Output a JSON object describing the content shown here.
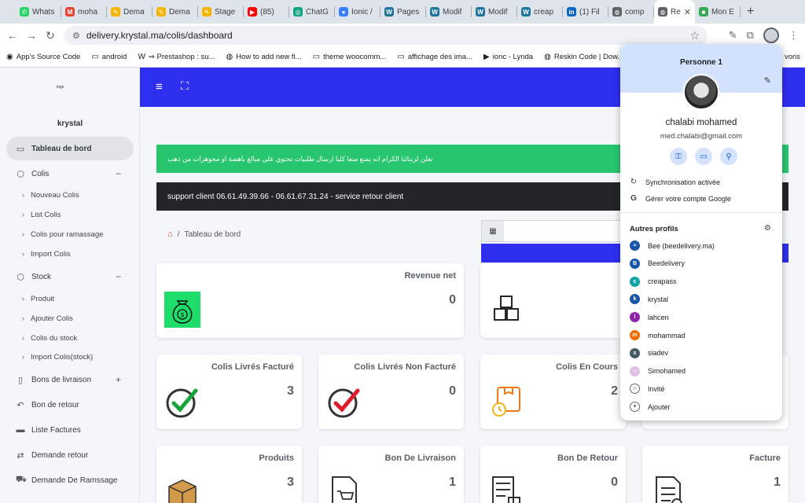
{
  "browser": {
    "tabs": [
      {
        "label": "Whats",
        "fav": "whatsapp-icon",
        "color": "#25d366",
        "glyph": "✆"
      },
      {
        "label": "moha",
        "fav": "gmail-icon",
        "color": "#ea4335",
        "glyph": "M"
      },
      {
        "label": "Dema",
        "fav": "page-icon",
        "color": "#f4b400",
        "glyph": "✎"
      },
      {
        "label": "Dema",
        "fav": "page-icon",
        "color": "#f4b400",
        "glyph": "✎"
      },
      {
        "label": "Stage",
        "fav": "page-icon",
        "color": "#f4b400",
        "glyph": "✎"
      },
      {
        "label": "(85)",
        "fav": "youtube-icon",
        "color": "#ff0000",
        "glyph": "▶"
      },
      {
        "label": "ChatG",
        "fav": "chatgpt-icon",
        "color": "#10a37f",
        "glyph": "◎"
      },
      {
        "label": "Ionic /",
        "fav": "ionic-icon",
        "color": "#3880ff",
        "glyph": "●"
      },
      {
        "label": "Pages",
        "fav": "wordpress-icon",
        "color": "#21759b",
        "glyph": "W"
      },
      {
        "label": "Modif",
        "fav": "wordpress-icon",
        "color": "#21759b",
        "glyph": "W"
      },
      {
        "label": "Modif",
        "fav": "wordpress-icon",
        "color": "#21759b",
        "glyph": "W"
      },
      {
        "label": "creap",
        "fav": "wordpress-icon",
        "color": "#21759b",
        "glyph": "W"
      },
      {
        "label": "(1) Fil",
        "fav": "linkedin-icon",
        "color": "#0a66c2",
        "glyph": "in"
      },
      {
        "label": "comp",
        "fav": "globe-icon",
        "color": "#5f6368",
        "glyph": "◍"
      },
      {
        "label": "Re",
        "fav": "globe-icon",
        "color": "#5f6368",
        "glyph": "◍"
      },
      {
        "label": "Mon E",
        "fav": "app-icon",
        "color": "#34a853",
        "glyph": "■"
      }
    ],
    "url": "delivery.krystal.ma/colis/dashboard",
    "bookmarks": [
      {
        "label": "App's Source Code",
        "icon": "folder-blue-icon",
        "glyph": "◉"
      },
      {
        "label": "android",
        "icon": "folder-icon",
        "glyph": "▭"
      },
      {
        "label": "⇒ Prestashop : su...",
        "icon": "wordpress-icon",
        "glyph": "W"
      },
      {
        "label": "How to add new fi...",
        "icon": "globe-icon",
        "glyph": "◍"
      },
      {
        "label": "theme woocomm...",
        "icon": "folder-icon",
        "glyph": "▭"
      },
      {
        "label": "affichage des ima...",
        "icon": "folder-icon",
        "glyph": "▭"
      },
      {
        "label": "ionc - Lynda",
        "icon": "video-icon",
        "glyph": "▶"
      },
      {
        "label": "Reskin Code | Dow...",
        "icon": "globe-icon",
        "glyph": "◍"
      },
      {
        "label": "voris",
        "icon": "folder-icon",
        "glyph": ""
      }
    ]
  },
  "sidebar": {
    "logo": "logo",
    "user": "krystal",
    "items": {
      "dashboard": "Tableau de bord",
      "colis": "Colis",
      "nouveau": "Nouveau Colis",
      "list": "List Colis",
      "ramassage": "Colis pour ramassage",
      "import": "Import Colis",
      "stock": "Stock",
      "produit": "Produit",
      "ajouter": "Ajouter Colis",
      "colis_stock": "Colis du stock",
      "import_stock": "Import Colis(stock)",
      "bons": "Bons de livraison",
      "retour": "Bon de retour",
      "factures": "Liste Factures",
      "demande_retour": "Demande retour",
      "demande_ramassage": "Demande De Ramssage"
    }
  },
  "main": {
    "alert_green": "نعلن لزبنائنا الكرام انه يمنع منعا كليا ارسال طلبيات تحتوي على مبالغ باهضة او مجوهرات من ذهب",
    "alert_dark": "support client 06.61.49.39.66 - 06.61.67.31.24 - service retour client",
    "breadcrumb": "Tableau de bord",
    "cards": {
      "revenue": {
        "title": "Revenue net",
        "value": "0"
      },
      "livres_f": {
        "title": "Colis Livrés Facturé",
        "value": "3"
      },
      "livres_nf": {
        "title": "Colis Livrés Non Facturé",
        "value": "0"
      },
      "en_cours": {
        "title": "Colis En Cours",
        "value": "2"
      },
      "produits": {
        "title": "Produits",
        "value": "3"
      },
      "bon_liv": {
        "title": "Bon De Livraison",
        "value": "1"
      },
      "bon_ret": {
        "title": "Bon De Retour",
        "value": "0"
      },
      "facture": {
        "title": "Facture",
        "value": "1"
      }
    }
  },
  "profile": {
    "header": "Personne 1",
    "name": "chalabi mohamed",
    "email": "med.chalabi@gmail.com",
    "sync": "Synchronisation activée",
    "manage": "Gérer votre compte Google",
    "others": "Autres profils",
    "profiles": [
      {
        "name": "Bee (beedelivery.ma)",
        "color": "#1a56a8",
        "initial": "≈"
      },
      {
        "name": "Beedelivery",
        "color": "#1a56a8",
        "initial": "B"
      },
      {
        "name": "creapass",
        "color": "#12a4a4",
        "initial": "c"
      },
      {
        "name": "krystal",
        "color": "#1a56a8",
        "initial": "k"
      },
      {
        "name": "lahcen",
        "color": "#8e24aa",
        "initial": "l"
      },
      {
        "name": "mohammad",
        "color": "#ef6c00",
        "initial": "m"
      },
      {
        "name": "siadev",
        "color": "#455a64",
        "initial": "s"
      },
      {
        "name": "Simohamed",
        "color": "#e1bee7",
        "initial": "☺"
      },
      {
        "name": "Invité",
        "color": "#ffffff",
        "initial": "☺"
      },
      {
        "name": "Ajouter",
        "color": "#ffffff",
        "initial": "+"
      }
    ]
  }
}
